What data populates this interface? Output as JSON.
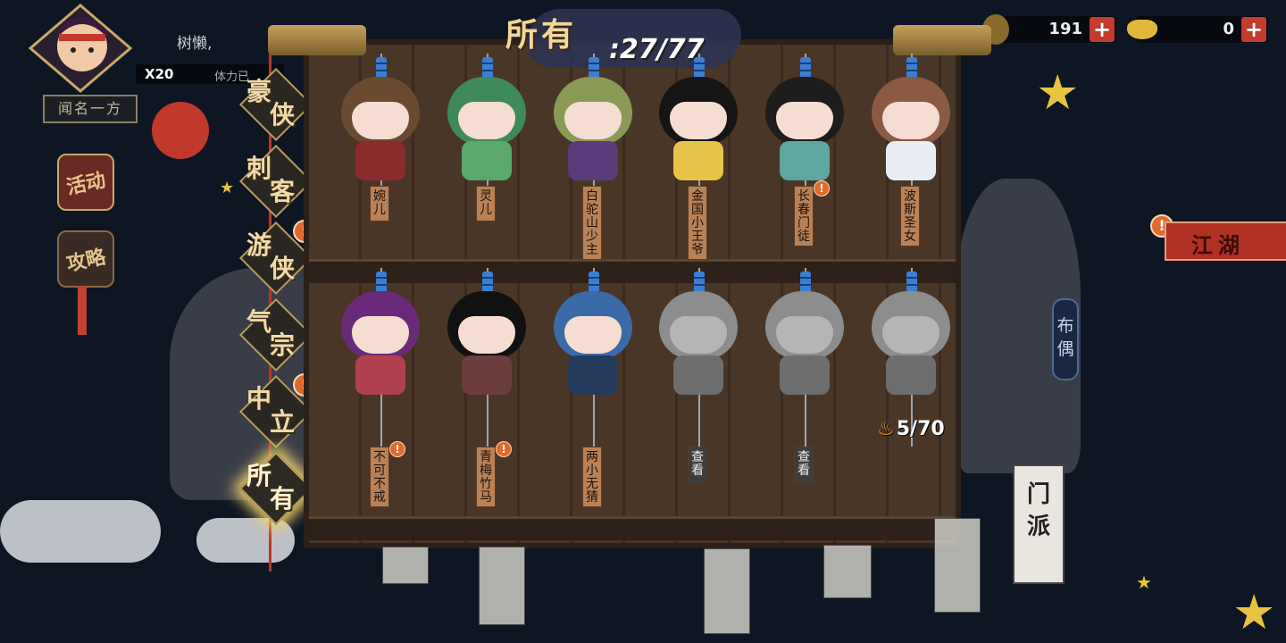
{
  "player": {
    "name": "树懒,",
    "stamina_count": "X20",
    "stamina_label": "体力已",
    "title": "闻名一方"
  },
  "side_menu": [
    {
      "label": "活动"
    },
    {
      "label": "攻略"
    }
  ],
  "currencies": [
    {
      "name": "copper-leaf",
      "value": "191"
    },
    {
      "name": "gold-ingot",
      "value": "0"
    }
  ],
  "header": {
    "label": "所有",
    "count": ":27/77"
  },
  "tabs": [
    {
      "c1": "豪",
      "c2": "侠",
      "alert": false,
      "active": false
    },
    {
      "c1": "刺",
      "c2": "客",
      "alert": false,
      "active": false
    },
    {
      "c1": "游",
      "c2": "侠",
      "alert": true,
      "active": false
    },
    {
      "c1": "气",
      "c2": "宗",
      "alert": false,
      "active": false
    },
    {
      "c1": "中",
      "c2": "立",
      "alert": true,
      "active": false
    },
    {
      "c1": "所",
      "c2": "有",
      "alert": false,
      "active": true
    }
  ],
  "dolls_row1": [
    {
      "name": "婉儿",
      "alert": false,
      "locked": false,
      "hat": "#6b4b2f",
      "body": "#8a2c2c"
    },
    {
      "name": "灵儿",
      "alert": false,
      "locked": false,
      "hat": "#3f8a5a",
      "body": "#5aa86a"
    },
    {
      "name": "白驼山少主",
      "alert": false,
      "locked": false,
      "hat": "#8a9a54",
      "body": "#5b3b7a"
    },
    {
      "name": "金国小王爷",
      "alert": false,
      "locked": false,
      "hat": "#151515",
      "body": "#e8c34a"
    },
    {
      "name": "长春门徒",
      "alert": true,
      "locked": false,
      "hat": "#1d1d1d",
      "body": "#5fa6a0"
    },
    {
      "name": "波斯圣女",
      "alert": false,
      "locked": false,
      "hat": "#8a5a42",
      "body": "#e9eef5"
    }
  ],
  "dolls_row2": [
    {
      "name": "不可不戒",
      "alert": true,
      "locked": false,
      "hat": "#6a2a7a",
      "body": "#b0404e"
    },
    {
      "name": "青梅竹马",
      "alert": true,
      "locked": false,
      "hat": "#111111",
      "body": "#6b3d3d"
    },
    {
      "name": "两小无猜",
      "alert": false,
      "locked": false,
      "hat": "#3a6aa8",
      "body": "#243b5e"
    },
    {
      "name": "查看",
      "alert": false,
      "locked": true,
      "hat": "#7a7a7a",
      "body": "#666666"
    },
    {
      "name": "查看",
      "alert": false,
      "locked": true,
      "hat": "#7a7a7a",
      "body": "#666666"
    },
    {
      "name": "",
      "alert": false,
      "locked": true,
      "hat": "#7a7a7a",
      "body": "#666666"
    }
  ],
  "progress": {
    "value": "5/70"
  },
  "right_panel": {
    "jianghu_label": "江湖",
    "doll_button_label": "布偶",
    "menpai_label": "门派"
  }
}
